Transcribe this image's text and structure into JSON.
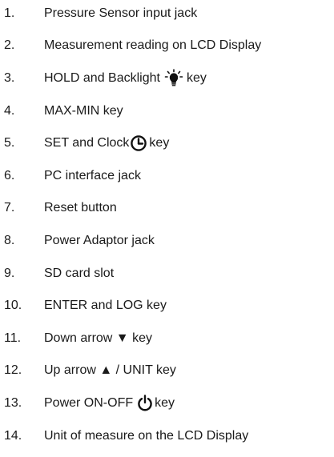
{
  "items": [
    {
      "number": "1.",
      "text": "Pressure Sensor input jack"
    },
    {
      "number": "2.",
      "text": "Measurement reading on LCD Display"
    },
    {
      "number": "3.",
      "text_before": "HOLD and Backlight",
      "icon": "backlight-bulb-icon",
      "text_after": "key"
    },
    {
      "number": "4.",
      "text": "MAX-MIN key"
    },
    {
      "number": "5.",
      "text_before": "SET and Clock",
      "icon": "clock-icon",
      "text_after": "key"
    },
    {
      "number": "6.",
      "text": "PC interface jack"
    },
    {
      "number": "7.",
      "text": "Reset button"
    },
    {
      "number": "8.",
      "text": "Power Adaptor jack"
    },
    {
      "number": "9.",
      "text": "SD card slot"
    },
    {
      "number": "10.",
      "text": "ENTER and LOG key"
    },
    {
      "number": "11.",
      "text": "Down arrow ▼ key"
    },
    {
      "number": "12.",
      "text": "Up arrow ▲ / UNIT key"
    },
    {
      "number": "13.",
      "text_before": "Power ON-OFF",
      "icon": "power-icon",
      "text_after": "key"
    },
    {
      "number": "14.",
      "text": "Unit of measure on the LCD Display"
    }
  ]
}
